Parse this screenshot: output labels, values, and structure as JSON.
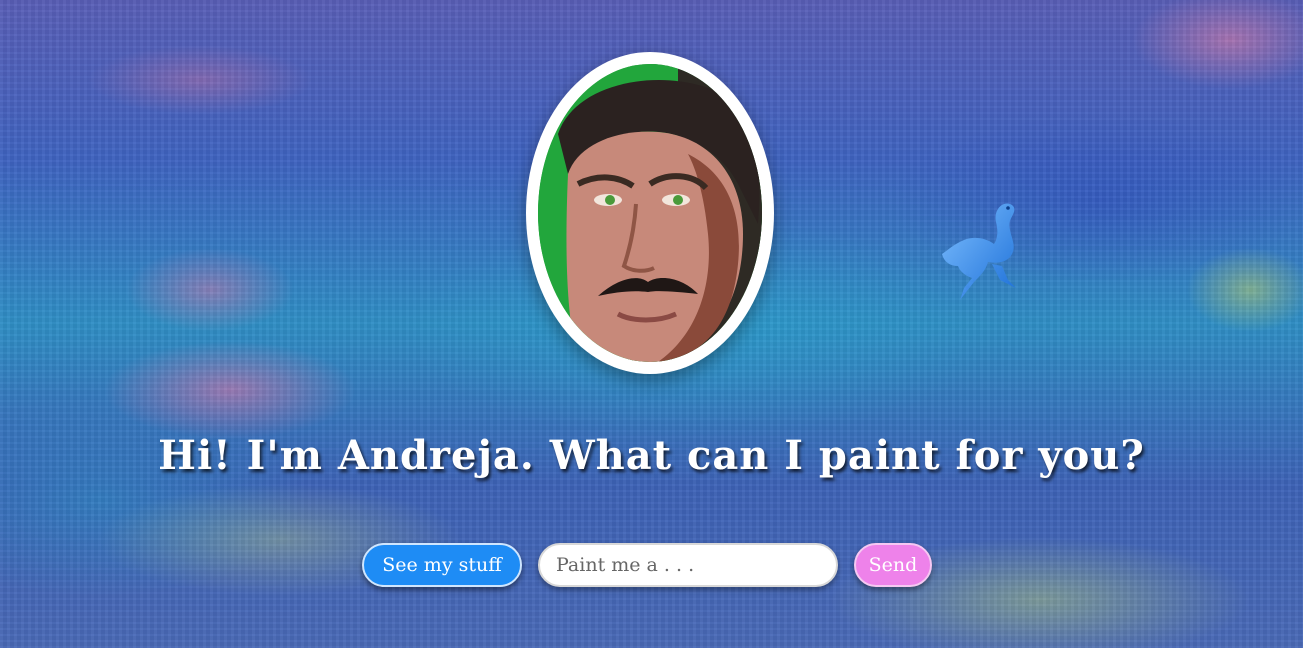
{
  "hero": {
    "headline": "Hi! I'm Andreja. What can I paint for you?",
    "portrait_icon": "painted-portrait",
    "mascot_icon": "ostrich-icon"
  },
  "actions": {
    "see_stuff_label": "See my stuff",
    "paint_input_value": "",
    "paint_input_placeholder": "Paint me a . . .",
    "send_label": "Send"
  },
  "colors": {
    "see_stuff_button": "#1e8cf5",
    "send_button": "#ee82ea",
    "headline_text": "#ffffff",
    "portrait_frame": "#ffffff",
    "mascot": "#2e86e6"
  }
}
